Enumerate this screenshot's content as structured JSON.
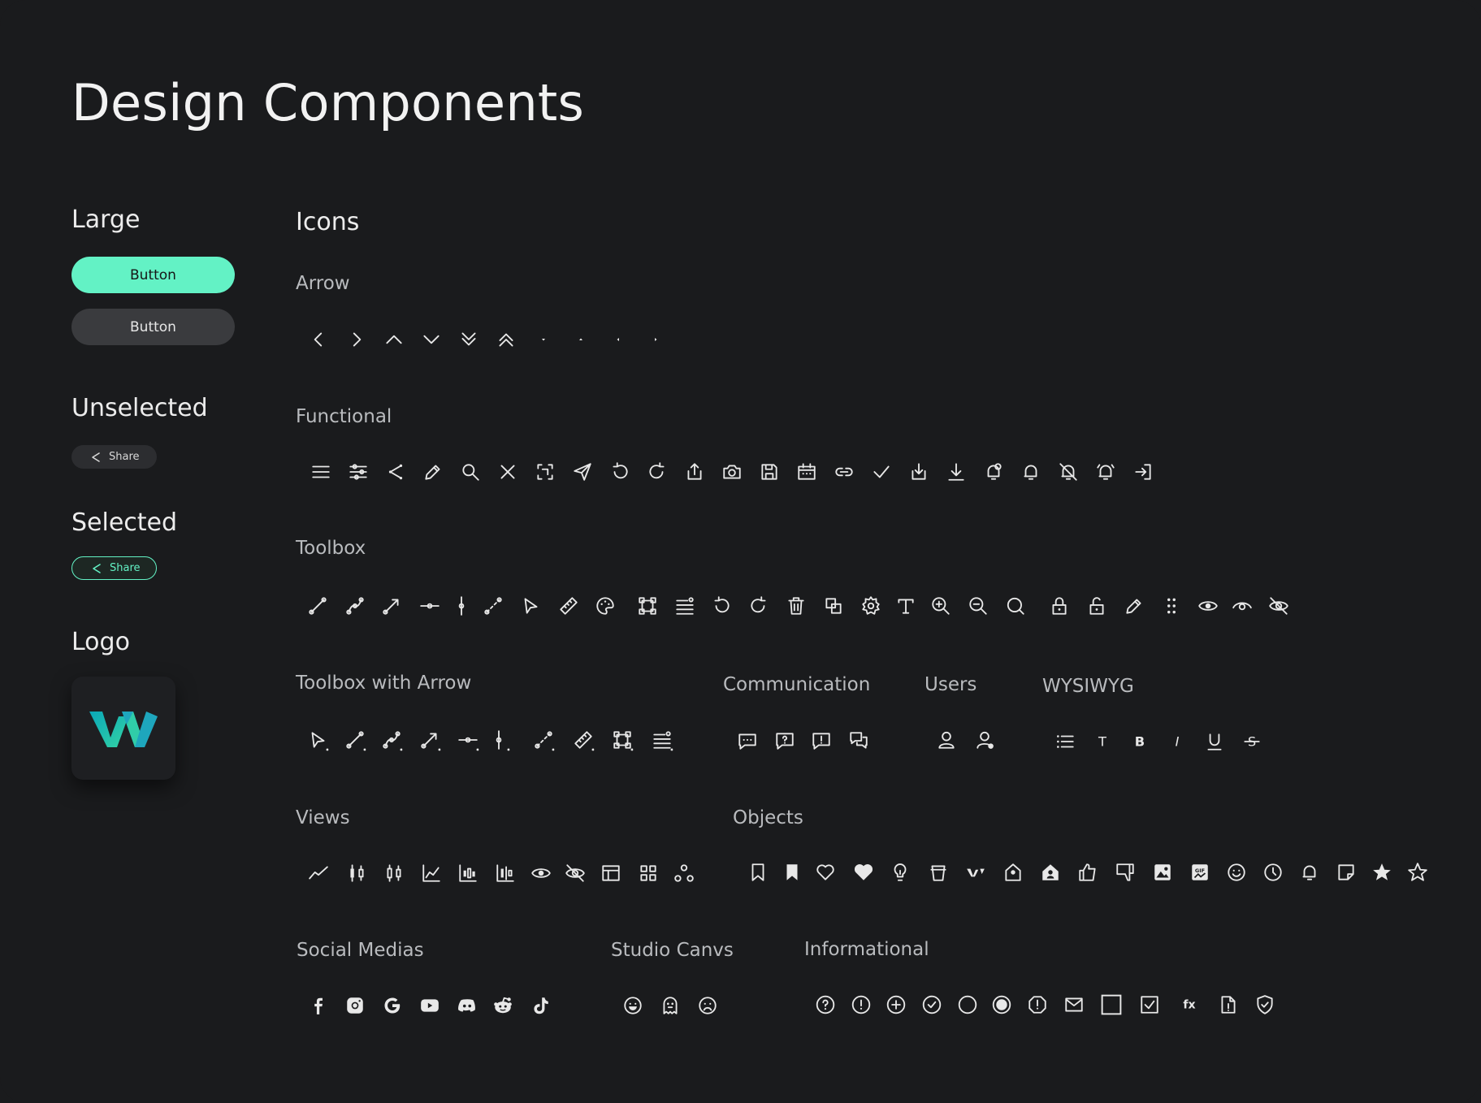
{
  "page": {
    "title": "Design Components"
  },
  "left": {
    "large": {
      "title": "Large",
      "primary_button": "Button",
      "secondary_button": "Button"
    },
    "unselected": {
      "title": "Unselected",
      "chip_label": "Share"
    },
    "selected": {
      "title": "Selected",
      "chip_label": "Share"
    },
    "logo": {
      "title": "Logo"
    }
  },
  "colors": {
    "accent": "#63f2c5",
    "background": "#1a1b1d",
    "secondary_button": "#3a3b3e",
    "logo_gradient": [
      "#0aa7b8",
      "#34d3a4"
    ]
  },
  "icons": {
    "title": "Icons",
    "groups": {
      "arrow": {
        "title": "Arrow",
        "items": [
          "chevron-left",
          "chevron-right",
          "chevron-up",
          "chevron-down",
          "double-chevron-down",
          "double-chevron-up",
          "caret-down",
          "caret-up",
          "caret-left",
          "caret-right"
        ]
      },
      "functional": {
        "title": "Functional",
        "items": [
          "menu",
          "sliders",
          "share",
          "pencil",
          "search",
          "close",
          "scan",
          "send",
          "undo",
          "redo",
          "upload",
          "camera",
          "save",
          "calendar",
          "link",
          "check",
          "download-tray",
          "download",
          "alarm-bell",
          "bell",
          "bell-off",
          "bell-ring",
          "login"
        ]
      },
      "toolbox": {
        "title": "Toolbox",
        "items": [
          "trend-line",
          "curve-line",
          "arrow-line",
          "horizontal-line",
          "vertical-line",
          "segment-line",
          "cursor",
          "ruler",
          "palette",
          "shape-select",
          "text-lines",
          "undo",
          "redo",
          "trash",
          "layers",
          "gear",
          "text-tool",
          "zoom-in",
          "zoom-out",
          "zoom",
          "lock",
          "unlock",
          "pencil",
          "drag-handle",
          "eye",
          "eye-dot",
          "eye-off"
        ]
      },
      "toolbox_arrow": {
        "title": "Toolbox with Arrow",
        "items": [
          "cursor",
          "trend-line",
          "curve-line",
          "arrow-line",
          "horizontal-line",
          "vertical-line",
          "segment-line",
          "ruler",
          "shape-select",
          "text-lines"
        ]
      },
      "communication": {
        "title": "Communication",
        "items": [
          "chat",
          "chat-question",
          "chat-alert",
          "chats"
        ]
      },
      "users": {
        "title": "Users",
        "items": [
          "user",
          "user-status"
        ]
      },
      "wysiwyg": {
        "title": "WYSIWYG",
        "items": [
          "list",
          "text",
          "bold",
          "italic",
          "underline",
          "strikethrough"
        ]
      },
      "views": {
        "title": "Views",
        "items": [
          "line-chart",
          "candles",
          "candles-outline",
          "area-chart",
          "bar-candles",
          "bar-candles-2",
          "eye",
          "eye-off",
          "layout",
          "grid",
          "nodes"
        ]
      },
      "objects": {
        "title": "Objects",
        "items": [
          "bookmark",
          "bookmark-filled",
          "heart",
          "heart-filled",
          "bulb",
          "cup",
          "brand-mark",
          "home-tag",
          "home-user",
          "thumbs-up",
          "thumbs-down",
          "image",
          "gif",
          "smile",
          "clock",
          "bell",
          "note",
          "star-filled",
          "star"
        ]
      },
      "social": {
        "title": "Social Medias",
        "items": [
          "facebook",
          "instagram",
          "google",
          "youtube",
          "discord",
          "reddit",
          "tiktok"
        ]
      },
      "studio": {
        "title": "Studio Canvs",
        "items": [
          "smile-face",
          "ghost",
          "sad-face"
        ]
      },
      "informational": {
        "title": "Informational",
        "items": [
          "help-circle",
          "alert-circle",
          "plus-circle",
          "check-circle",
          "circle",
          "radio-filled",
          "alert-octagon",
          "mail",
          "square",
          "checkbox",
          "fx",
          "file-info",
          "shield-check"
        ],
        "fx_label": "fx"
      }
    }
  },
  "wysiwyg_glyphs": {
    "text": "T",
    "bold": "B",
    "italic": "I",
    "underline": "U",
    "strike": "S"
  }
}
